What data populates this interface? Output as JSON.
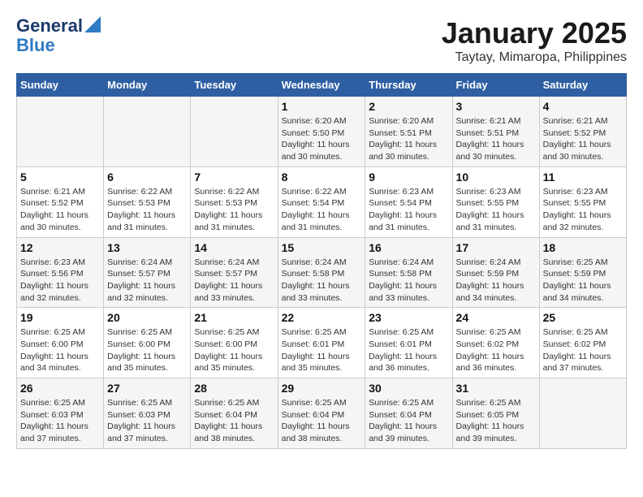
{
  "logo": {
    "line1": "General",
    "line2": "Blue"
  },
  "title": "January 2025",
  "location": "Taytay, Mimaropa, Philippines",
  "days_of_week": [
    "Sunday",
    "Monday",
    "Tuesday",
    "Wednesday",
    "Thursday",
    "Friday",
    "Saturday"
  ],
  "weeks": [
    [
      {
        "day": "",
        "info": ""
      },
      {
        "day": "",
        "info": ""
      },
      {
        "day": "",
        "info": ""
      },
      {
        "day": "1",
        "info": "Sunrise: 6:20 AM\nSunset: 5:50 PM\nDaylight: 11 hours and 30 minutes."
      },
      {
        "day": "2",
        "info": "Sunrise: 6:20 AM\nSunset: 5:51 PM\nDaylight: 11 hours and 30 minutes."
      },
      {
        "day": "3",
        "info": "Sunrise: 6:21 AM\nSunset: 5:51 PM\nDaylight: 11 hours and 30 minutes."
      },
      {
        "day": "4",
        "info": "Sunrise: 6:21 AM\nSunset: 5:52 PM\nDaylight: 11 hours and 30 minutes."
      }
    ],
    [
      {
        "day": "5",
        "info": "Sunrise: 6:21 AM\nSunset: 5:52 PM\nDaylight: 11 hours and 30 minutes."
      },
      {
        "day": "6",
        "info": "Sunrise: 6:22 AM\nSunset: 5:53 PM\nDaylight: 11 hours and 31 minutes."
      },
      {
        "day": "7",
        "info": "Sunrise: 6:22 AM\nSunset: 5:53 PM\nDaylight: 11 hours and 31 minutes."
      },
      {
        "day": "8",
        "info": "Sunrise: 6:22 AM\nSunset: 5:54 PM\nDaylight: 11 hours and 31 minutes."
      },
      {
        "day": "9",
        "info": "Sunrise: 6:23 AM\nSunset: 5:54 PM\nDaylight: 11 hours and 31 minutes."
      },
      {
        "day": "10",
        "info": "Sunrise: 6:23 AM\nSunset: 5:55 PM\nDaylight: 11 hours and 31 minutes."
      },
      {
        "day": "11",
        "info": "Sunrise: 6:23 AM\nSunset: 5:55 PM\nDaylight: 11 hours and 32 minutes."
      }
    ],
    [
      {
        "day": "12",
        "info": "Sunrise: 6:23 AM\nSunset: 5:56 PM\nDaylight: 11 hours and 32 minutes."
      },
      {
        "day": "13",
        "info": "Sunrise: 6:24 AM\nSunset: 5:57 PM\nDaylight: 11 hours and 32 minutes."
      },
      {
        "day": "14",
        "info": "Sunrise: 6:24 AM\nSunset: 5:57 PM\nDaylight: 11 hours and 33 minutes."
      },
      {
        "day": "15",
        "info": "Sunrise: 6:24 AM\nSunset: 5:58 PM\nDaylight: 11 hours and 33 minutes."
      },
      {
        "day": "16",
        "info": "Sunrise: 6:24 AM\nSunset: 5:58 PM\nDaylight: 11 hours and 33 minutes."
      },
      {
        "day": "17",
        "info": "Sunrise: 6:24 AM\nSunset: 5:59 PM\nDaylight: 11 hours and 34 minutes."
      },
      {
        "day": "18",
        "info": "Sunrise: 6:25 AM\nSunset: 5:59 PM\nDaylight: 11 hours and 34 minutes."
      }
    ],
    [
      {
        "day": "19",
        "info": "Sunrise: 6:25 AM\nSunset: 6:00 PM\nDaylight: 11 hours and 34 minutes."
      },
      {
        "day": "20",
        "info": "Sunrise: 6:25 AM\nSunset: 6:00 PM\nDaylight: 11 hours and 35 minutes."
      },
      {
        "day": "21",
        "info": "Sunrise: 6:25 AM\nSunset: 6:00 PM\nDaylight: 11 hours and 35 minutes."
      },
      {
        "day": "22",
        "info": "Sunrise: 6:25 AM\nSunset: 6:01 PM\nDaylight: 11 hours and 35 minutes."
      },
      {
        "day": "23",
        "info": "Sunrise: 6:25 AM\nSunset: 6:01 PM\nDaylight: 11 hours and 36 minutes."
      },
      {
        "day": "24",
        "info": "Sunrise: 6:25 AM\nSunset: 6:02 PM\nDaylight: 11 hours and 36 minutes."
      },
      {
        "day": "25",
        "info": "Sunrise: 6:25 AM\nSunset: 6:02 PM\nDaylight: 11 hours and 37 minutes."
      }
    ],
    [
      {
        "day": "26",
        "info": "Sunrise: 6:25 AM\nSunset: 6:03 PM\nDaylight: 11 hours and 37 minutes."
      },
      {
        "day": "27",
        "info": "Sunrise: 6:25 AM\nSunset: 6:03 PM\nDaylight: 11 hours and 37 minutes."
      },
      {
        "day": "28",
        "info": "Sunrise: 6:25 AM\nSunset: 6:04 PM\nDaylight: 11 hours and 38 minutes."
      },
      {
        "day": "29",
        "info": "Sunrise: 6:25 AM\nSunset: 6:04 PM\nDaylight: 11 hours and 38 minutes."
      },
      {
        "day": "30",
        "info": "Sunrise: 6:25 AM\nSunset: 6:04 PM\nDaylight: 11 hours and 39 minutes."
      },
      {
        "day": "31",
        "info": "Sunrise: 6:25 AM\nSunset: 6:05 PM\nDaylight: 11 hours and 39 minutes."
      },
      {
        "day": "",
        "info": ""
      }
    ]
  ]
}
